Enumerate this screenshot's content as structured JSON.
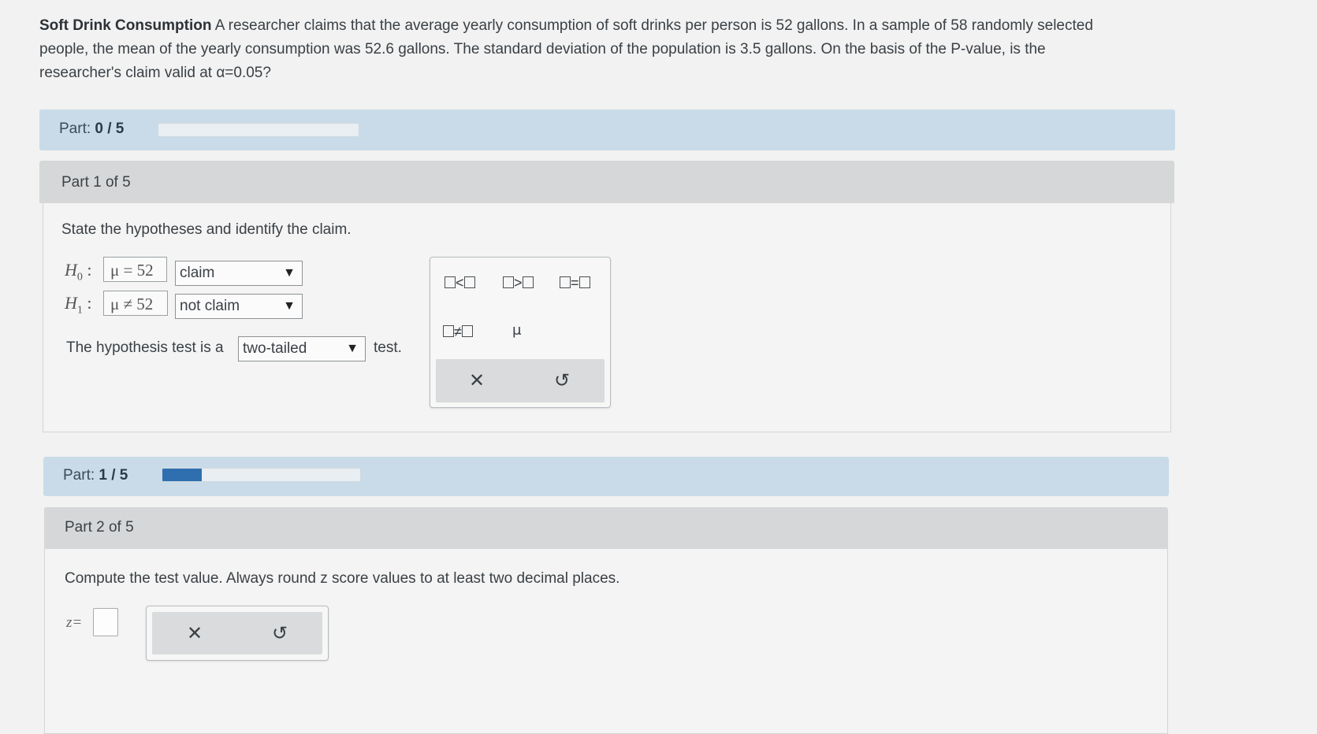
{
  "problem": {
    "title": "Soft Drink Consumption",
    "line1": "A researcher claims that the average yearly consumption of soft drinks per person is 52 gallons. In a sample of 58 randomly selected",
    "line2": "people, the mean of the yearly consumption was 52.6 gallons. The standard deviation of the population is 3.5 gallons. On the basis of the P-value, is the",
    "line3": "researcher's claim valid at α=0.05?"
  },
  "progress1": {
    "label": "Part:",
    "value": "0 / 5",
    "fraction": 0.0
  },
  "part1": {
    "header": "Part 1 of 5",
    "instruction": "State the hypotheses and identify the claim.",
    "h0_label": "H",
    "h0_sub": "0",
    "h1_label": "H",
    "h1_sub": "1",
    "colon": ":",
    "h0_value": "μ = 52",
    "h1_value": "μ ≠ 52",
    "h0_select": "claim",
    "h1_select": "not claim",
    "test_prefix": "The hypothesis test is a",
    "test_select": "two-tailed",
    "test_suffix": "test."
  },
  "palette1": {
    "lt": "<",
    "gt": ">",
    "eq": "=",
    "ne": "≠",
    "mu": "μ",
    "clear": "✕",
    "undo": "↺"
  },
  "progress2": {
    "label": "Part:",
    "value": "1 / 5",
    "fraction": 0.2
  },
  "part2": {
    "header": "Part 2 of 5",
    "instruction": "Compute the test value. Always round z score values to at least two decimal places.",
    "z_label": "z="
  },
  "palette2": {
    "clear": "✕",
    "undo": "↺"
  },
  "colors": {
    "accent": "#2f6fb0",
    "progress_bg": "#c9dbe8",
    "header_bg": "#d5d7d8"
  }
}
